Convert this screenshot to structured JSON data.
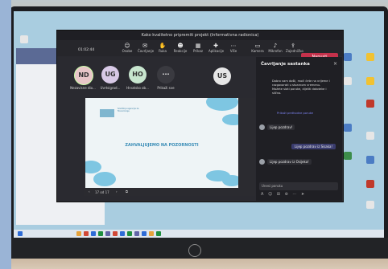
{
  "meeting": {
    "title": "Kako kvalitetno pripremiti projekt (Informativna radionica)",
    "timer": "01:02:44",
    "leave_label": "Napusti"
  },
  "toolbar": {
    "items": [
      {
        "icon": "users-icon",
        "label": "Osobe"
      },
      {
        "icon": "chat-icon",
        "label": "Čavrljanje"
      },
      {
        "icon": "hand-icon",
        "label": "Ruka"
      },
      {
        "icon": "reactions-icon",
        "label": "Reakcije"
      },
      {
        "icon": "view-icon",
        "label": "Prikaz"
      },
      {
        "icon": "apps-icon",
        "label": "Aplikacije"
      },
      {
        "icon": "more-icon",
        "label": "Više"
      },
      {
        "icon": "camera-icon",
        "label": "Kamera"
      },
      {
        "icon": "mic-icon",
        "label": "Mikrofon"
      },
      {
        "icon": "share-icon",
        "label": "Zajedničko"
      }
    ]
  },
  "participants": [
    {
      "initials": "ND",
      "name": "Nezavisne dio...",
      "color": "#e8c6c8"
    },
    {
      "initials": "UG",
      "name": "Uvrtsigrad...",
      "color": "#d8c9e6"
    },
    {
      "initials": "HO",
      "name": "Hrvatsko ob...",
      "color": "#c8e6cf"
    },
    {
      "initials": "···",
      "name": "Prikaži sve",
      "color": "#3a3a40"
    },
    {
      "initials": "US",
      "name": "",
      "color": "#e6e6e6"
    }
  ],
  "slide": {
    "title": "ZAHVALJUJEMO NA POZORNOSTI",
    "logo_text": "Središnja agencija za financiranje"
  },
  "slide_controls": {
    "page": "17 od 17"
  },
  "chat": {
    "title": "Čavrljanje sastanka",
    "intro": "Dobro vam došli, moći ćete na vrijeme i razgovarati u stvarnom vremenu. Možete slati poruke, dijeliti datoteke i slično.",
    "link": "Prikaži prethodne poruke",
    "messages": [
      {
        "text": "Lijep pozdrav!",
        "side": "left"
      },
      {
        "text": "Lijep pozdrav iz Sisaka!",
        "side": "right"
      },
      {
        "text": "Lijep pozdrav iz Osijeka!",
        "side": "left"
      }
    ],
    "input_placeholder": "Unesi poruku"
  },
  "colors": {
    "accent": "#6264a7",
    "leave": "#c4314b",
    "slide_blue": "#7ec6e2"
  }
}
